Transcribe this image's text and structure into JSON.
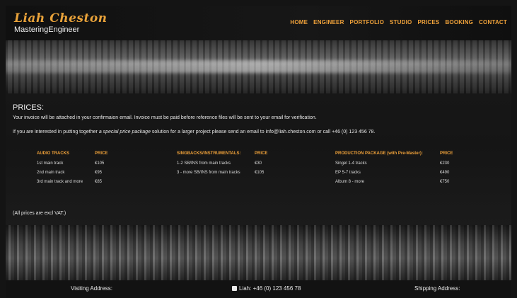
{
  "header": {
    "logo_script": "Liah Cheston",
    "logo_sub": "MasteringEngineer",
    "nav": [
      "HOME",
      "ENGINEER",
      "PORTFOLIO",
      "STUDIO",
      "PRICES",
      "BOOKING",
      "CONTACT"
    ]
  },
  "prices": {
    "title": "PRICES:",
    "line1": "Your invoice will be attached in your confirmaion email. Invoice must be paid before reference files will be sent to your email for verification.",
    "line2_before": "If you are interested in putting together ",
    "line2_em": "a special price package",
    "line2_after": " solution for a larger project please send an email to info@liah.cheston.com or call +46 (0) 123 456 78.",
    "tables": [
      {
        "head": "AUDIO TRACKS",
        "price_head": "PRICE",
        "rows": [
          {
            "item": "1st main track",
            "price": "€105"
          },
          {
            "item": "2nd main track",
            "price": "€95"
          },
          {
            "item": "3rd main track and more",
            "price": "€85"
          }
        ]
      },
      {
        "head": "SINGBACKS/INSTRUMENTALS:",
        "price_head": "PRICE",
        "rows": [
          {
            "item": "1-2 SB/INS from main tracks",
            "price": "€30"
          },
          {
            "item": "3 - more SB/INS from main tracks",
            "price": "€105"
          }
        ]
      },
      {
        "head": "PRODUCTION PACKAGE (with Pre-Master):",
        "price_head": "PRICE",
        "rows": [
          {
            "item": "Singel 1-4 tracks",
            "price": "€230"
          },
          {
            "item": "EP 5-7 tracks",
            "price": "€490"
          },
          {
            "item": "Album 8 - more",
            "price": "€750"
          }
        ]
      }
    ],
    "vat_note": "(All prices are excl VAT.)"
  },
  "footer": {
    "visiting": "Visiting Address:",
    "phone": "Liah: +46 (0) 123 456 78",
    "shipping": "Shipping Address:"
  },
  "colors": {
    "accent": "#f0a23a",
    "background": "#151515"
  }
}
